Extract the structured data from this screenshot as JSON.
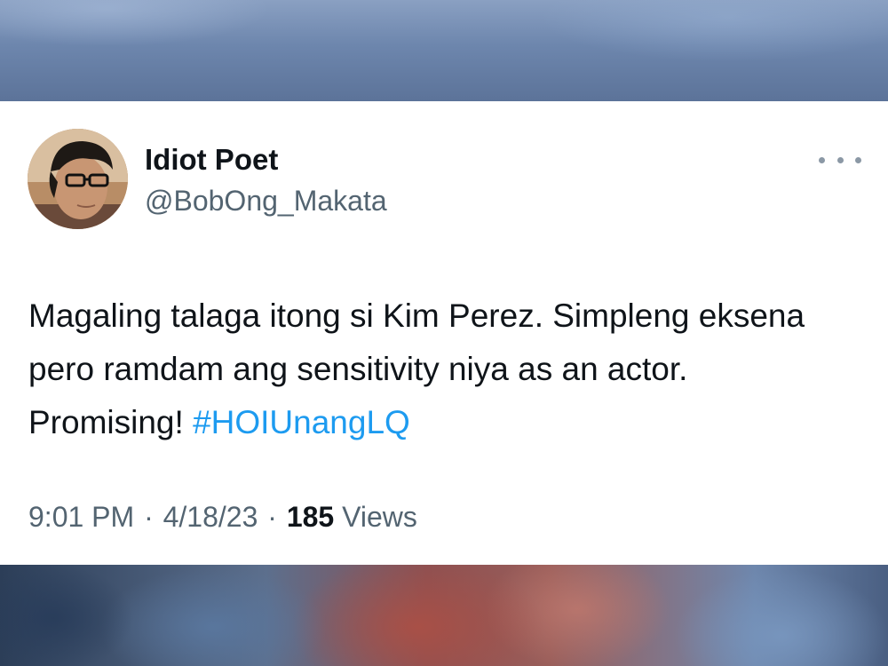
{
  "tweet": {
    "author": {
      "display_name": "Idiot Poet",
      "handle": "@BobOng_Makata",
      "avatar_icon": "profile-photo"
    },
    "more_icon": "more-horizontal-icon",
    "text": "Magaling talaga itong si Kim Perez. Simpleng eksena pero ramdam ang sensitivity niya as an actor. Promising!",
    "hashtag": "#HOIUnangLQ",
    "time": "9:01 PM",
    "date": "4/18/23",
    "separator": "·",
    "views_count": "185",
    "views_label": "Views"
  },
  "colors": {
    "text_primary": "#0f1419",
    "text_secondary": "#536471",
    "link": "#1d9bf0",
    "card_bg": "#ffffff"
  }
}
